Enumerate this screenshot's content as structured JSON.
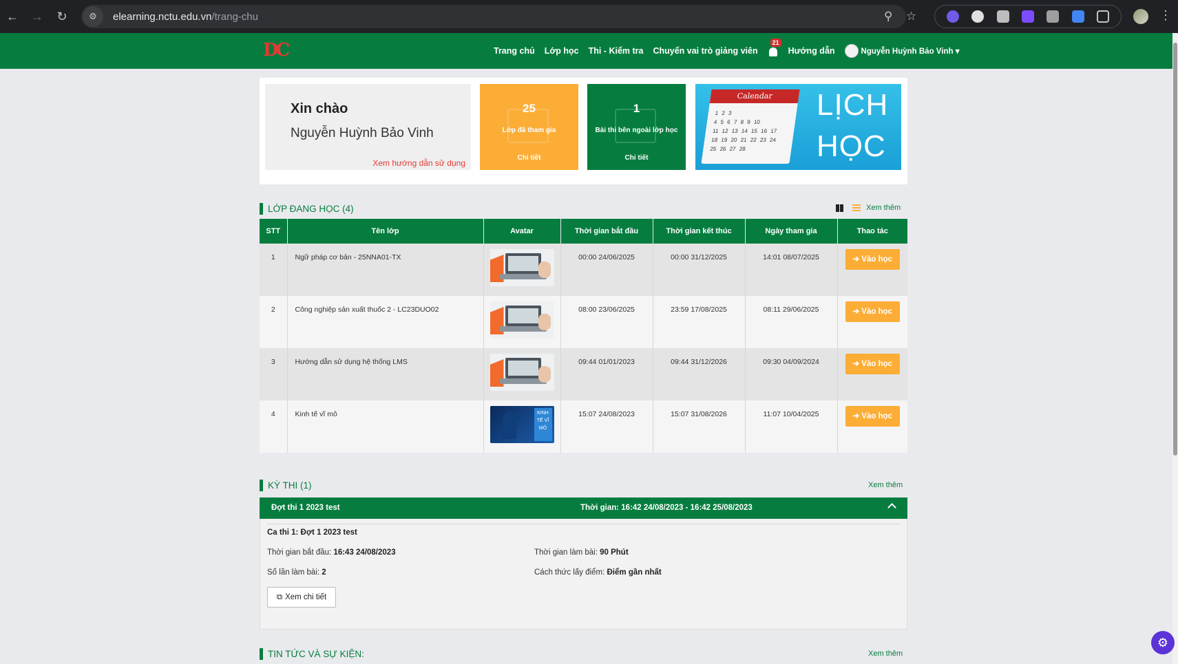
{
  "browser": {
    "url_host": "elearning.nctu.edu.vn",
    "url_path": "/trang-chu"
  },
  "header": {
    "menu": [
      "Trang chủ",
      "Lớp học",
      "Thi - Kiểm tra",
      "Chuyển vai trò giảng viên"
    ],
    "notification_count": "21",
    "guide": "Hướng dẫn",
    "user_name": "Nguyễn Huỳnh Bảo Vinh"
  },
  "greeting": {
    "hello": "Xin chào",
    "name": "Nguyễn Huỳnh Bảo Vinh",
    "guide_link": "Xem hướng dẫn sử dụng"
  },
  "stats": [
    {
      "number": "25",
      "label": "Lớp đã tham gia",
      "more": "Chi tiết",
      "color": "#fbad36"
    },
    {
      "number": "1",
      "label": "Bài thi bên ngoài lớp học",
      "more": "Chi tiết",
      "color": "#067d3f"
    }
  ],
  "calendar_banner": {
    "calendar_title": "Calendar",
    "line1": "LỊCH",
    "line2": "HỌC"
  },
  "classes": {
    "title": "LỚP ĐANG HỌC (4)",
    "see_more": "Xem thêm",
    "columns": [
      "STT",
      "Tên lớp",
      "Avatar",
      "Thời gian bắt đầu",
      "Thời gian kết thúc",
      "Ngày tham gia",
      "Thao tác"
    ],
    "rows": [
      {
        "stt": "1",
        "name": "Ngữ pháp cơ bản - 25NNA01-TX",
        "avatar": "laptop",
        "start": "00:00 24/06/2025",
        "end": "00:00 31/12/2025",
        "joined": "14:01 08/07/2025",
        "action": "Vào học"
      },
      {
        "stt": "2",
        "name": "Công nghiệp sản xuất thuốc 2 - LC23DUO02",
        "avatar": "laptop",
        "start": "08:00 23/06/2025",
        "end": "23:59 17/08/2025",
        "joined": "08:11 29/06/2025",
        "action": "Vào học"
      },
      {
        "stt": "3",
        "name": "Hướng dẫn sử dụng hệ thống LMS",
        "avatar": "laptop",
        "start": "09:44 01/01/2023",
        "end": "09:44 31/12/2026",
        "joined": "09:30 04/09/2024",
        "action": "Vào học"
      },
      {
        "stt": "4",
        "name": "Kinh tế vĩ mô",
        "avatar": "macro",
        "avatar_text": "KINH TẾ VĨ MÔ",
        "start": "15:07 24/08/2023",
        "end": "15:07 31/08/2026",
        "joined": "11:07 10/04/2025",
        "action": "Vào học"
      }
    ]
  },
  "exams": {
    "title": "KỲ THI (1)",
    "see_more": "Xem thêm",
    "round_name": "Đợt thi 1 2023 test",
    "round_time": "Thời gian: 16:42 24/08/2023 - 16:42 25/08/2023",
    "session": "Ca thi  1: Đợt 1 2023 test",
    "start_label": "Thời gian bắt đầu: ",
    "start_value": "16:43 24/08/2023",
    "duration_label": "Thời gian làm bài: ",
    "duration_value": "90 Phút",
    "attempts_label": "Số lần làm bài: ",
    "attempts_value": "2",
    "scoring_label": "Cách thức lấy điểm: ",
    "scoring_value": "Điểm gần nhất",
    "detail_button": "Xem chi tiết"
  },
  "news": {
    "title": "TIN TỨC VÀ SỰ KIỆN:",
    "see_more": "Xem thêm"
  },
  "colors": {
    "brand_green": "#067d3f",
    "accent_orange": "#fbad36",
    "link_red": "#e53935"
  }
}
